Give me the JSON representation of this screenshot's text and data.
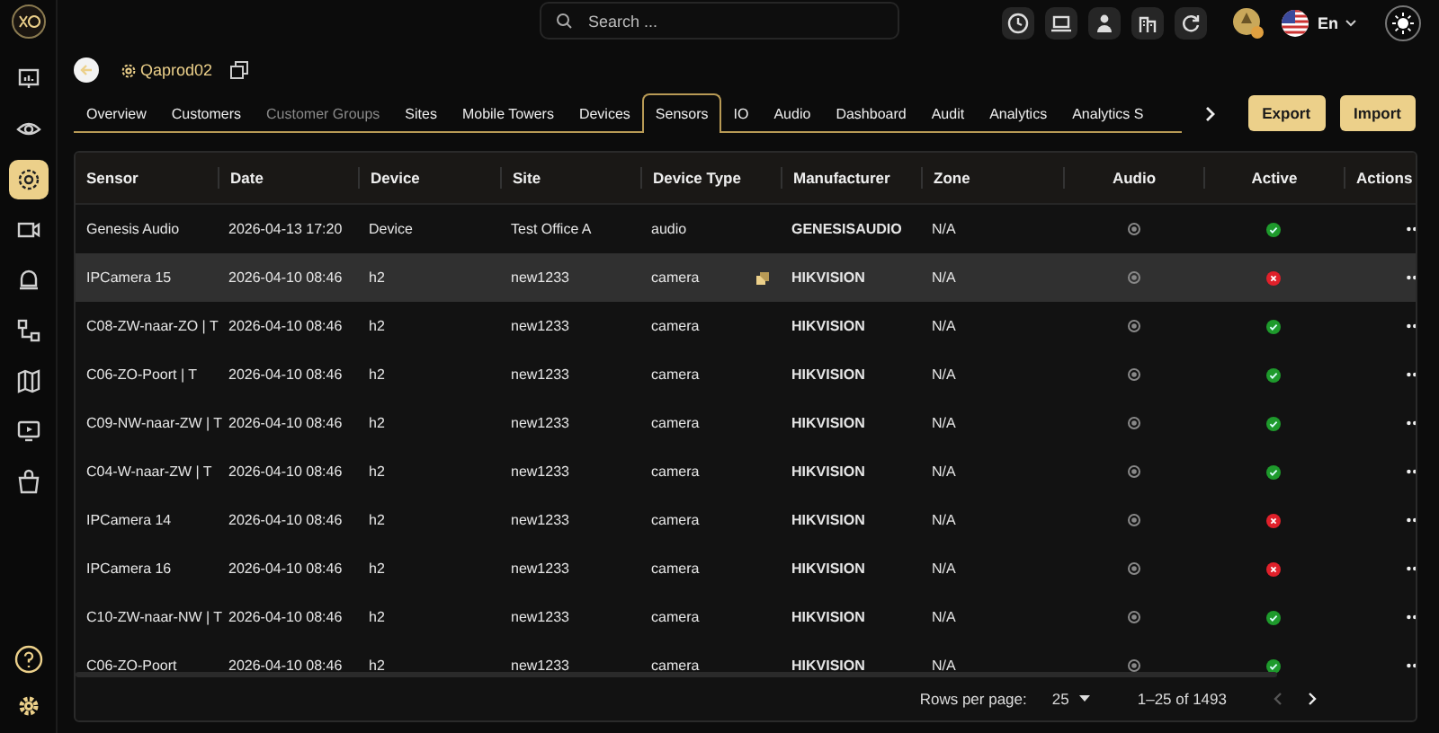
{
  "sidebar": {
    "items": [
      {
        "selected": false
      },
      {
        "selected": false
      },
      {
        "selected": true
      },
      {
        "selected": false
      },
      {
        "selected": false
      },
      {
        "selected": false
      },
      {
        "selected": false
      },
      {
        "selected": false
      },
      {
        "selected": false
      }
    ]
  },
  "topbar": {
    "search": {
      "placeholder": "Search ..."
    },
    "language": "En"
  },
  "header": {
    "title": "Qaprod02"
  },
  "tabs": [
    {
      "label": "Overview",
      "selected": false,
      "disabled": false
    },
    {
      "label": "Customers",
      "selected": false,
      "disabled": false
    },
    {
      "label": "Customer Groups",
      "selected": false,
      "disabled": true
    },
    {
      "label": "Sites",
      "selected": false,
      "disabled": false
    },
    {
      "label": "Mobile Towers",
      "selected": false,
      "disabled": false
    },
    {
      "label": "Devices",
      "selected": false,
      "disabled": false
    },
    {
      "label": "Sensors",
      "selected": true,
      "disabled": false
    },
    {
      "label": "IO",
      "selected": false,
      "disabled": false
    },
    {
      "label": "Audio",
      "selected": false,
      "disabled": false
    },
    {
      "label": "Dashboard",
      "selected": false,
      "disabled": false
    },
    {
      "label": "Audit",
      "selected": false,
      "disabled": false
    },
    {
      "label": "Analytics",
      "selected": false,
      "disabled": false
    },
    {
      "label": "Analytics S",
      "selected": false,
      "disabled": false
    }
  ],
  "buttons": [
    "Export",
    "Import"
  ],
  "table": {
    "columns": [
      "Sensor",
      "Date",
      "Device",
      "Site",
      "Device Type",
      "Manufacturer",
      "Zone",
      "Audio",
      "Active",
      "Actions"
    ],
    "rows": [
      {
        "sensor": "Genesis Audio",
        "date": "2026-04-13 17:20",
        "device": "Device",
        "site": "Test Office A",
        "device_type": "audio",
        "manufacturer": "GENESISAUDIO",
        "zone": "N/A",
        "active": true,
        "selected": false
      },
      {
        "sensor": "IPCamera 15",
        "date": "2026-04-10 08:46",
        "device": "h2",
        "site": "new1233",
        "device_type": "camera",
        "manufacturer": "HIKVISION",
        "zone": "N/A",
        "active": false,
        "selected": true
      },
      {
        "sensor": "C08-ZW-naar-ZO | T",
        "date": "2026-04-10 08:46",
        "device": "h2",
        "site": "new1233",
        "device_type": "camera",
        "manufacturer": "HIKVISION",
        "zone": "N/A",
        "active": true,
        "selected": false
      },
      {
        "sensor": "C06-ZO-Poort | T",
        "date": "2026-04-10 08:46",
        "device": "h2",
        "site": "new1233",
        "device_type": "camera",
        "manufacturer": "HIKVISION",
        "zone": "N/A",
        "active": true,
        "selected": false
      },
      {
        "sensor": "C09-NW-naar-ZW | T",
        "date": "2026-04-10 08:46",
        "device": "h2",
        "site": "new1233",
        "device_type": "camera",
        "manufacturer": "HIKVISION",
        "zone": "N/A",
        "active": true,
        "selected": false
      },
      {
        "sensor": "C04-W-naar-ZW | T",
        "date": "2026-04-10 08:46",
        "device": "h2",
        "site": "new1233",
        "device_type": "camera",
        "manufacturer": "HIKVISION",
        "zone": "N/A",
        "active": true,
        "selected": false
      },
      {
        "sensor": "IPCamera 14",
        "date": "2026-04-10 08:46",
        "device": "h2",
        "site": "new1233",
        "device_type": "camera",
        "manufacturer": "HIKVISION",
        "zone": "N/A",
        "active": false,
        "selected": false
      },
      {
        "sensor": "IPCamera 16",
        "date": "2026-04-10 08:46",
        "device": "h2",
        "site": "new1233",
        "device_type": "camera",
        "manufacturer": "HIKVISION",
        "zone": "N/A",
        "active": false,
        "selected": false
      },
      {
        "sensor": "C10-ZW-naar-NW | T",
        "date": "2026-04-10 08:46",
        "device": "h2",
        "site": "new1233",
        "device_type": "camera",
        "manufacturer": "HIKVISION",
        "zone": "N/A",
        "active": true,
        "selected": false
      },
      {
        "sensor": "C06-ZO-Poort",
        "date": "2026-04-10 08:46",
        "device": "h2",
        "site": "new1233",
        "device_type": "camera",
        "manufacturer": "HIKVISION",
        "zone": "N/A",
        "active": true,
        "selected": false
      }
    ]
  },
  "pagination": {
    "rows_per_page_label": "Rows per page:",
    "rows_per_page": "25",
    "range": "1–25 of 1493"
  }
}
